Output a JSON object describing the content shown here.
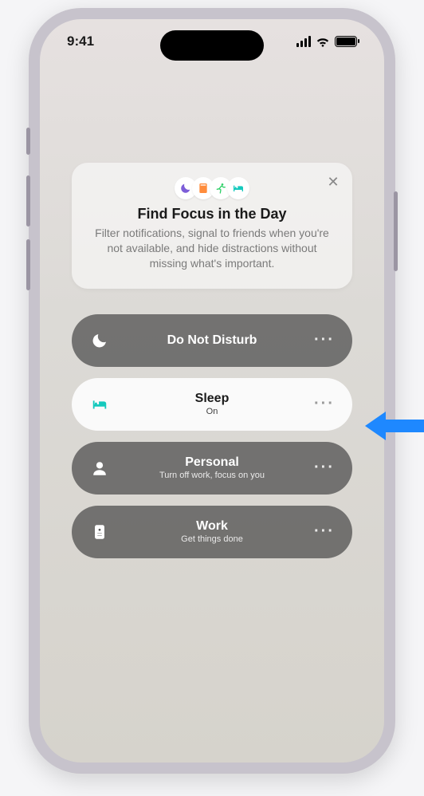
{
  "status": {
    "time": "9:41"
  },
  "card": {
    "title": "Find Focus in the Day",
    "description": "Filter notifications, signal to friends when you're not available, and hide distractions without missing what's important."
  },
  "colors": {
    "dnd": "#7d5ed8",
    "reading": "#ff8c3b",
    "fitness": "#2fd068",
    "sleep": "#14c9bd"
  },
  "focus": [
    {
      "icon": "moon",
      "name": "Do Not Disturb",
      "sub": "",
      "active": false
    },
    {
      "icon": "bed",
      "name": "Sleep",
      "sub": "On",
      "active": true
    },
    {
      "icon": "person",
      "name": "Personal",
      "sub": "Turn off work, focus on you",
      "active": false
    },
    {
      "icon": "badge",
      "name": "Work",
      "sub": "Get things done",
      "active": false
    }
  ]
}
